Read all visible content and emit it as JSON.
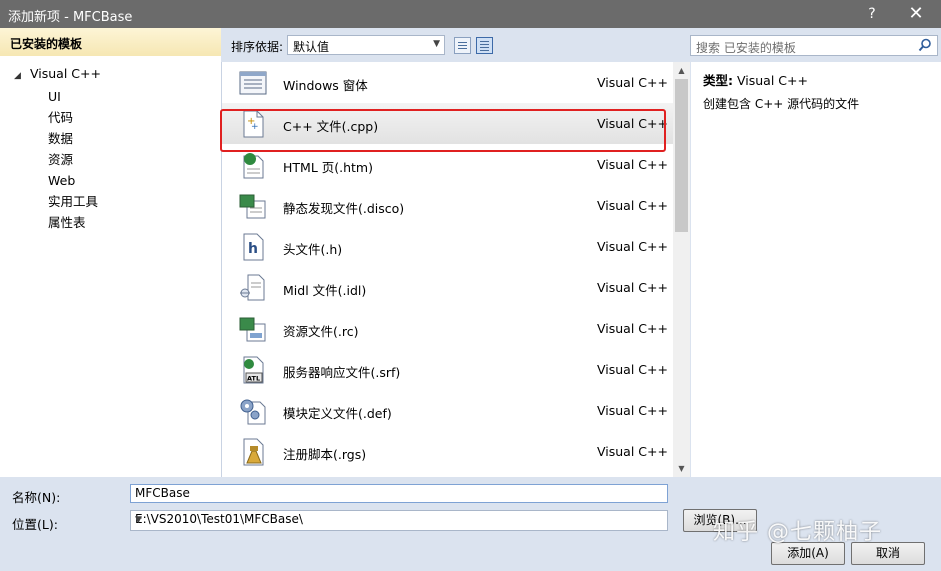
{
  "window": {
    "title": "添加新项 - MFCBase",
    "help": "?",
    "close": "✕"
  },
  "left": {
    "header": "已安装的模板",
    "root": "Visual C++",
    "children": [
      "UI",
      "代码",
      "数据",
      "资源",
      "Web",
      "实用工具",
      "属性表"
    ]
  },
  "sort": {
    "label": "排序依据:",
    "selected": "默认值",
    "search_placeholder": "搜索 已安装的模板"
  },
  "templates": [
    {
      "name": "Windows 窗体",
      "lang": "Visual C++",
      "icon": "form-icon"
    },
    {
      "name": "C++ 文件(.cpp)",
      "lang": "Visual C++",
      "icon": "cpp-file-icon",
      "selected": true
    },
    {
      "name": "HTML 页(.htm)",
      "lang": "Visual C++",
      "icon": "html-page-icon"
    },
    {
      "name": "静态发现文件(.disco)",
      "lang": "Visual C++",
      "icon": "disco-file-icon"
    },
    {
      "name": "头文件(.h)",
      "lang": "Visual C++",
      "icon": "header-file-icon"
    },
    {
      "name": "Midl 文件(.idl)",
      "lang": "Visual C++",
      "icon": "idl-file-icon"
    },
    {
      "name": "资源文件(.rc)",
      "lang": "Visual C++",
      "icon": "resource-file-icon"
    },
    {
      "name": "服务器响应文件(.srf)",
      "lang": "Visual C++",
      "icon": "srf-file-icon"
    },
    {
      "name": "模块定义文件(.def)",
      "lang": "Visual C++",
      "icon": "def-file-icon"
    },
    {
      "name": "注册脚本(.rgs)",
      "lang": "Visual C++",
      "icon": "rgs-file-icon"
    }
  ],
  "details": {
    "type_label": "类型:",
    "type_value": "Visual C++",
    "description": "创建包含 C++ 源代码的文件"
  },
  "form": {
    "name_label": "名称(N):",
    "name_value": "MFCBase",
    "location_label": "位置(L):",
    "location_value": "E:\\VS2010\\Test01\\MFCBase\\",
    "browse": "浏览(B)...",
    "add": "添加(A)",
    "cancel": "取消"
  },
  "watermark": "知乎 @七颗柚子",
  "colors": {
    "titlebar": "#6b6b6b",
    "dialog_bg": "#dbe3ef",
    "highlight": "#e02020"
  }
}
